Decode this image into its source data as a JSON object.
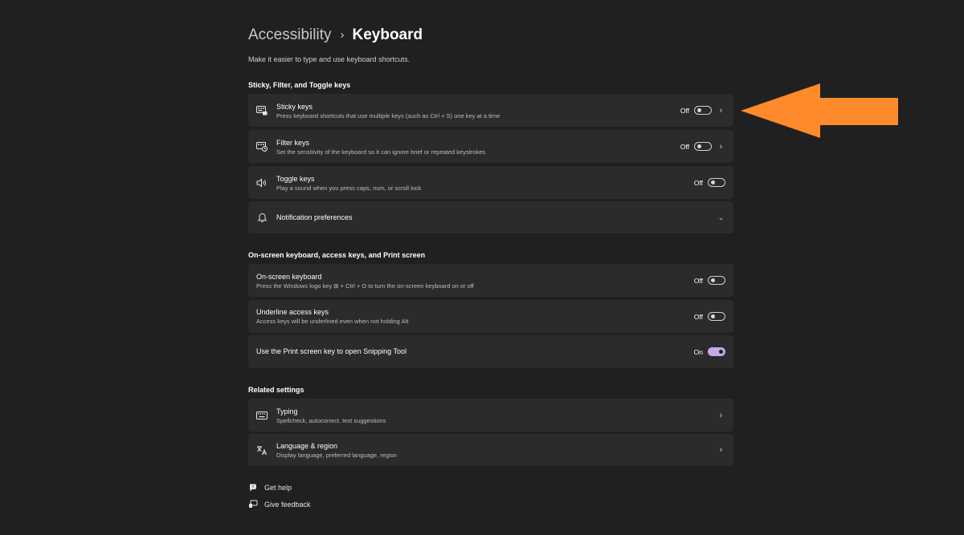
{
  "breadcrumb": {
    "parent": "Accessibility",
    "separator": "›",
    "current": "Keyboard"
  },
  "subtitle": "Make it easier to type and use keyboard shortcuts.",
  "sections": {
    "sticky": {
      "title": "Sticky, Filter, and Toggle keys",
      "items": [
        {
          "title": "Sticky keys",
          "desc": "Press keyboard shortcuts that use multiple keys (such as Ctrl + S) one key at a time",
          "state": "Off",
          "icon": "sticky-keys-icon"
        },
        {
          "title": "Filter keys",
          "desc": "Set the sensitivity of the keyboard so it can ignore brief or repeated keystrokes",
          "state": "Off",
          "icon": "filter-keys-icon"
        },
        {
          "title": "Toggle keys",
          "desc": "Play a sound when you press caps, num, or scroll lock",
          "state": "Off",
          "icon": "speaker-icon"
        },
        {
          "title": "Notification preferences",
          "icon": "bell-icon"
        }
      ]
    },
    "onscreen": {
      "title": "On-screen keyboard, access keys, and Print screen",
      "items": [
        {
          "title": "On-screen keyboard",
          "desc": "Press the Windows logo key ⊞ + Ctrl + O to turn the on-screen keyboard on or off",
          "state": "Off"
        },
        {
          "title": "Underline access keys",
          "desc": "Access keys will be underlined even when not holding Alt",
          "state": "Off"
        },
        {
          "title": "Use the Print screen key to open Snipping Tool",
          "state": "On"
        }
      ]
    },
    "related": {
      "title": "Related settings",
      "items": [
        {
          "title": "Typing",
          "desc": "Spellcheck, autocorrect, text suggestions",
          "icon": "keyboard-icon"
        },
        {
          "title": "Language & region",
          "desc": "Display language, preferred language, region",
          "icon": "language-icon"
        }
      ]
    }
  },
  "footer": {
    "help": "Get help",
    "feedback": "Give feedback"
  },
  "colors": {
    "background": "#202020",
    "card": "#2b2b2b",
    "accent": "#c9a7e8",
    "annotation_arrow": "#ff8a2b"
  }
}
